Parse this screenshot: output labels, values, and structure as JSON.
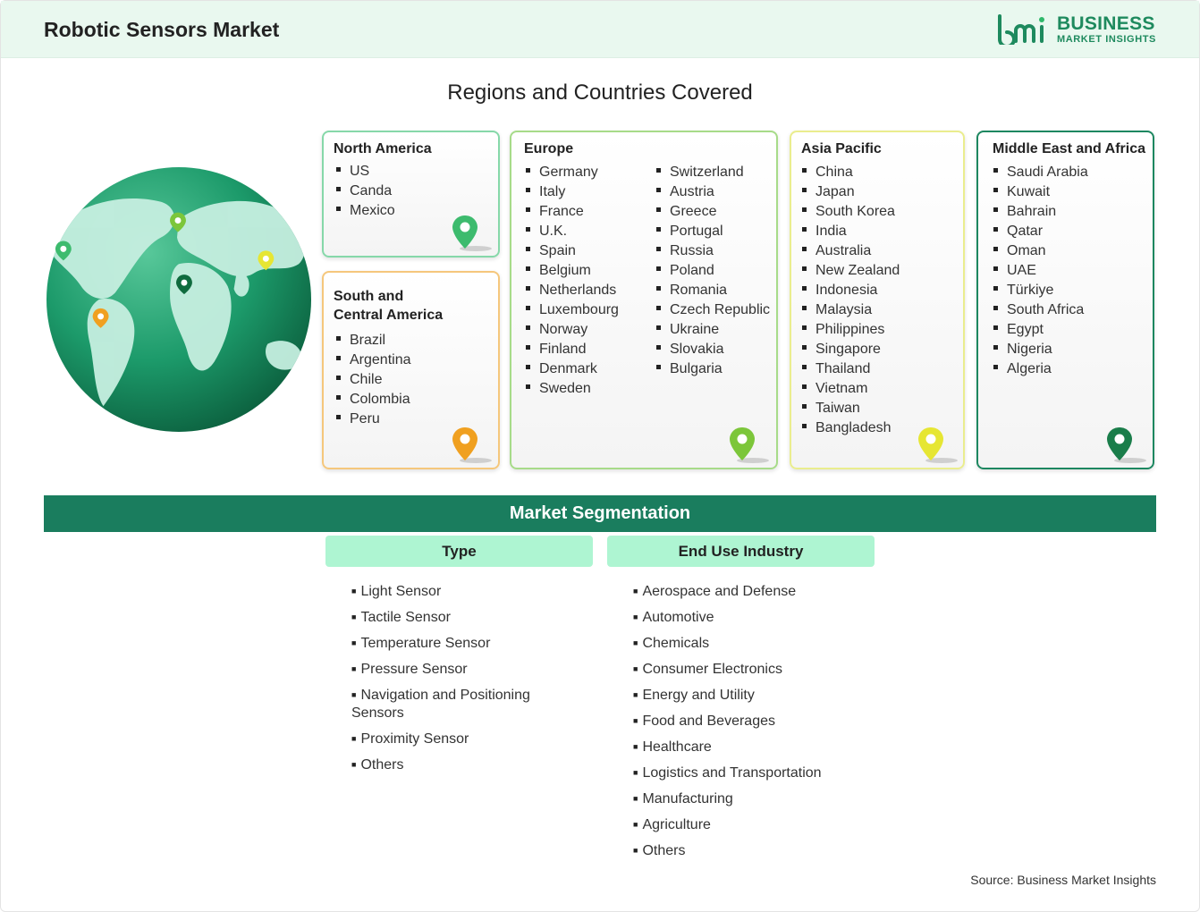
{
  "header": {
    "title": "Robotic Sensors Market",
    "logo_word1": "BUSINESS",
    "logo_word2": "MARKET INSIGHTS",
    "brand_color": "#1e8a5e"
  },
  "regions": {
    "title": "Regions and Countries Covered",
    "north_america": {
      "label": "North America",
      "countries": [
        "US",
        "Canda",
        "Mexico"
      ],
      "color": "#3dbb6e"
    },
    "south_central_america": {
      "label_line1": "South and",
      "label_line2": "Central America",
      "countries": [
        "Brazil",
        "Argentina",
        "Chile",
        "Colombia",
        "Peru"
      ],
      "color": "#f0a020"
    },
    "europe": {
      "label": "Europe",
      "col1": [
        "Germany",
        "Italy",
        "France",
        "U.K.",
        "Spain",
        "Belgium",
        "Netherlands",
        "Luxembourg",
        "Norway",
        "Finland",
        "Denmark",
        "Sweden"
      ],
      "col2": [
        "Switzerland",
        "Austria",
        "Greece",
        "Portugal",
        "Russia",
        "Poland",
        "Romania",
        "Czech Republic",
        "Ukraine",
        "Slovakia",
        "Bulgaria"
      ],
      "color": "#7cc63a"
    },
    "asia_pacific": {
      "label": "Asia Pacific",
      "countries": [
        "China",
        "Japan",
        "South Korea",
        "India",
        "Australia",
        "New Zealand",
        "Indonesia",
        "Malaysia",
        "Philippines",
        "Singapore",
        "Thailand",
        "Vietnam",
        "Taiwan",
        "Bangladesh"
      ],
      "color": "#e6e633"
    },
    "middle_east_africa": {
      "label": "Middle East and Africa",
      "countries": [
        "Saudi Arabia",
        "Kuwait",
        "Bahrain",
        "Qatar",
        "Oman",
        "UAE",
        "Türkiye",
        "South Africa",
        "Egypt",
        "Nigeria",
        "Algeria"
      ],
      "color": "#1a7d4a"
    }
  },
  "segmentation": {
    "title": "Market Segmentation",
    "type": {
      "label": "Type",
      "items": [
        "Light Sensor",
        "Tactile Sensor",
        "Temperature Sensor",
        "Pressure Sensor",
        "Navigation and Positioning Sensors",
        "Proximity Sensor",
        "Others"
      ]
    },
    "end_use": {
      "label": "End Use Industry",
      "items": [
        "Aerospace and Defense",
        "Automotive",
        "Chemicals",
        "Consumer Electronics",
        "Energy and Utility",
        "Food and Beverages",
        "Healthcare",
        "Logistics and Transportation",
        "Manufacturing",
        "Agriculture",
        "Others"
      ]
    }
  },
  "footer": {
    "source": "Source: Business Market Insights"
  }
}
